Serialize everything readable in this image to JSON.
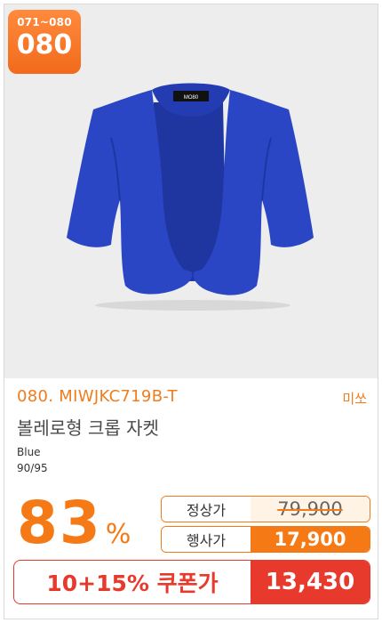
{
  "badge": {
    "range": "071~080",
    "number": "080"
  },
  "product": {
    "code": "080. MIWJKC719B-T",
    "brand": "미쏘",
    "name": "볼레로형 크롭 자켓",
    "color": "Blue",
    "size": "90/95",
    "label_text": "MO80"
  },
  "pricing": {
    "discount_number": "83",
    "discount_sign": "%",
    "normal_label": "정상가",
    "normal_price": "79,900",
    "sale_label": "행사가",
    "sale_price": "17,900"
  },
  "coupon": {
    "label": "10+15% 쿠폰가",
    "price": "13,430"
  },
  "colors": {
    "accent": "#f57a16",
    "coupon": "#e83a2c",
    "jacket": "#2a46c4"
  }
}
